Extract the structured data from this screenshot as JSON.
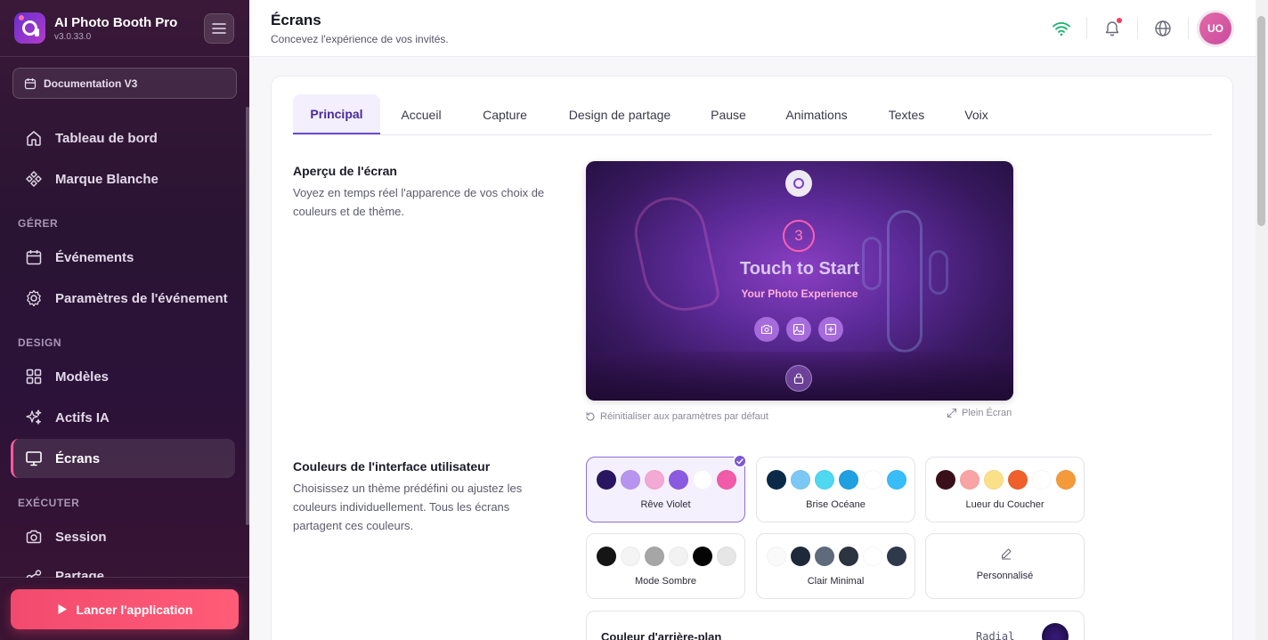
{
  "app": {
    "name": "AI Photo Booth Pro",
    "version": "v3.0.33.0"
  },
  "sidebar": {
    "doc_button": "Documentation V3",
    "items": [
      {
        "label": "Tableau de bord"
      },
      {
        "label": "Marque Blanche"
      },
      {
        "label": "Événements"
      },
      {
        "label": "Paramètres de l'événement"
      },
      {
        "label": "Modèles"
      },
      {
        "label": "Actifs IA"
      },
      {
        "label": "Écrans"
      },
      {
        "label": "Session"
      },
      {
        "label": "Partage"
      }
    ],
    "sections": {
      "manage": "GÉRER",
      "design": "DESIGN",
      "run": "EXÉCUTER"
    },
    "launch_button": "Lancer l'application"
  },
  "header": {
    "title": "Écrans",
    "subtitle": "Concevez l'expérience de vos invités.",
    "avatar_initials": "UO"
  },
  "tabs": [
    "Principal",
    "Accueil",
    "Capture",
    "Design de partage",
    "Pause",
    "Animations",
    "Textes",
    "Voix"
  ],
  "preview_section": {
    "title": "Aperçu de l'écran",
    "description": "Voyez en temps réel l'apparence de vos choix de couleurs et de thème.",
    "countdown": "3",
    "screen_title": "Touch to Start",
    "screen_subtitle": "Your Photo Experience",
    "reset_link": "Réinitialiser aux paramètres par défaut",
    "fullscreen_link": "Plein Écran"
  },
  "colors_section": {
    "title": "Couleurs de l'interface utilisateur",
    "description": "Choisissez un thème prédéfini ou ajustez les couleurs individuellement. Tous les écrans partagent ces couleurs.",
    "themes": [
      {
        "name": "Rêve Violet",
        "colors": [
          "#2a1560",
          "#b794f0",
          "#f4a8d4",
          "#8a5ae0",
          "#ffffff",
          "#f05ca8"
        ]
      },
      {
        "name": "Brise Océane",
        "colors": [
          "#0c2a48",
          "#7cc8f4",
          "#4fd8f0",
          "#1fa0e0",
          "#ffffff",
          "#38bdf8"
        ]
      },
      {
        "name": "Lueur du Coucher",
        "colors": [
          "#3a0f1c",
          "#f8a4a4",
          "#fbe08a",
          "#f0602a",
          "#ffffff",
          "#f59a3a"
        ]
      },
      {
        "name": "Mode Sombre",
        "colors": [
          "#151515",
          "#f4f4f4",
          "#a6a6a6",
          "#f2f2f2",
          "#050505",
          "#e6e6e6"
        ]
      },
      {
        "name": "Clair Minimal",
        "colors": [
          "#fafafa",
          "#1e2a3a",
          "#5f6b7d",
          "#2b3440",
          "#ffffff",
          "#2e3a4c"
        ]
      }
    ],
    "custom_label": "Personnalisé",
    "background_label": "Couleur d'arrière-plan",
    "background_mode": "Radial"
  }
}
